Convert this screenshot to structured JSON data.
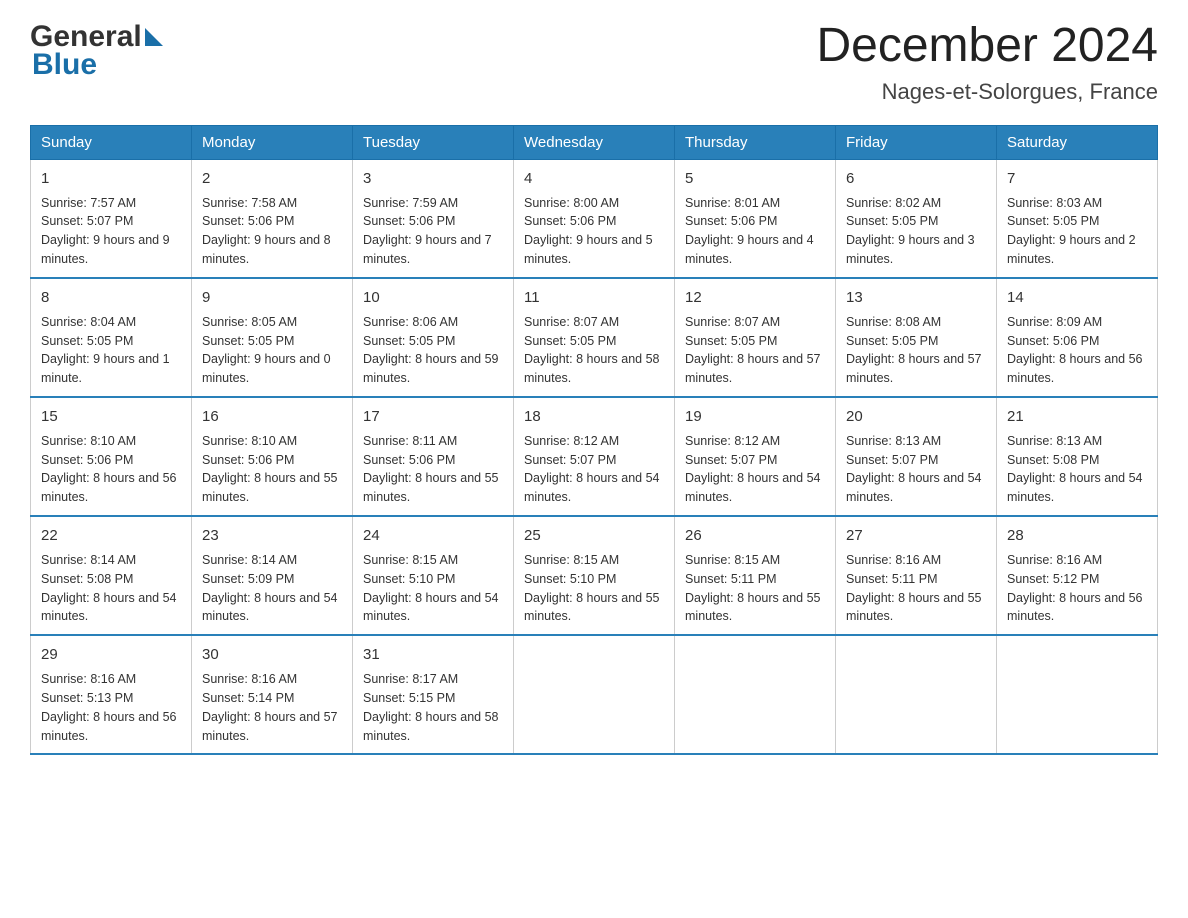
{
  "header": {
    "title": "December 2024",
    "subtitle": "Nages-et-Solorgues, France",
    "logo_general": "General",
    "logo_blue": "Blue"
  },
  "days_of_week": [
    "Sunday",
    "Monday",
    "Tuesday",
    "Wednesday",
    "Thursday",
    "Friday",
    "Saturday"
  ],
  "weeks": [
    [
      {
        "day": "1",
        "sunrise": "7:57 AM",
        "sunset": "5:07 PM",
        "daylight": "9 hours and 9 minutes."
      },
      {
        "day": "2",
        "sunrise": "7:58 AM",
        "sunset": "5:06 PM",
        "daylight": "9 hours and 8 minutes."
      },
      {
        "day": "3",
        "sunrise": "7:59 AM",
        "sunset": "5:06 PM",
        "daylight": "9 hours and 7 minutes."
      },
      {
        "day": "4",
        "sunrise": "8:00 AM",
        "sunset": "5:06 PM",
        "daylight": "9 hours and 5 minutes."
      },
      {
        "day": "5",
        "sunrise": "8:01 AM",
        "sunset": "5:06 PM",
        "daylight": "9 hours and 4 minutes."
      },
      {
        "day": "6",
        "sunrise": "8:02 AM",
        "sunset": "5:05 PM",
        "daylight": "9 hours and 3 minutes."
      },
      {
        "day": "7",
        "sunrise": "8:03 AM",
        "sunset": "5:05 PM",
        "daylight": "9 hours and 2 minutes."
      }
    ],
    [
      {
        "day": "8",
        "sunrise": "8:04 AM",
        "sunset": "5:05 PM",
        "daylight": "9 hours and 1 minute."
      },
      {
        "day": "9",
        "sunrise": "8:05 AM",
        "sunset": "5:05 PM",
        "daylight": "9 hours and 0 minutes."
      },
      {
        "day": "10",
        "sunrise": "8:06 AM",
        "sunset": "5:05 PM",
        "daylight": "8 hours and 59 minutes."
      },
      {
        "day": "11",
        "sunrise": "8:07 AM",
        "sunset": "5:05 PM",
        "daylight": "8 hours and 58 minutes."
      },
      {
        "day": "12",
        "sunrise": "8:07 AM",
        "sunset": "5:05 PM",
        "daylight": "8 hours and 57 minutes."
      },
      {
        "day": "13",
        "sunrise": "8:08 AM",
        "sunset": "5:05 PM",
        "daylight": "8 hours and 57 minutes."
      },
      {
        "day": "14",
        "sunrise": "8:09 AM",
        "sunset": "5:06 PM",
        "daylight": "8 hours and 56 minutes."
      }
    ],
    [
      {
        "day": "15",
        "sunrise": "8:10 AM",
        "sunset": "5:06 PM",
        "daylight": "8 hours and 56 minutes."
      },
      {
        "day": "16",
        "sunrise": "8:10 AM",
        "sunset": "5:06 PM",
        "daylight": "8 hours and 55 minutes."
      },
      {
        "day": "17",
        "sunrise": "8:11 AM",
        "sunset": "5:06 PM",
        "daylight": "8 hours and 55 minutes."
      },
      {
        "day": "18",
        "sunrise": "8:12 AM",
        "sunset": "5:07 PM",
        "daylight": "8 hours and 54 minutes."
      },
      {
        "day": "19",
        "sunrise": "8:12 AM",
        "sunset": "5:07 PM",
        "daylight": "8 hours and 54 minutes."
      },
      {
        "day": "20",
        "sunrise": "8:13 AM",
        "sunset": "5:07 PM",
        "daylight": "8 hours and 54 minutes."
      },
      {
        "day": "21",
        "sunrise": "8:13 AM",
        "sunset": "5:08 PM",
        "daylight": "8 hours and 54 minutes."
      }
    ],
    [
      {
        "day": "22",
        "sunrise": "8:14 AM",
        "sunset": "5:08 PM",
        "daylight": "8 hours and 54 minutes."
      },
      {
        "day": "23",
        "sunrise": "8:14 AM",
        "sunset": "5:09 PM",
        "daylight": "8 hours and 54 minutes."
      },
      {
        "day": "24",
        "sunrise": "8:15 AM",
        "sunset": "5:10 PM",
        "daylight": "8 hours and 54 minutes."
      },
      {
        "day": "25",
        "sunrise": "8:15 AM",
        "sunset": "5:10 PM",
        "daylight": "8 hours and 55 minutes."
      },
      {
        "day": "26",
        "sunrise": "8:15 AM",
        "sunset": "5:11 PM",
        "daylight": "8 hours and 55 minutes."
      },
      {
        "day": "27",
        "sunrise": "8:16 AM",
        "sunset": "5:11 PM",
        "daylight": "8 hours and 55 minutes."
      },
      {
        "day": "28",
        "sunrise": "8:16 AM",
        "sunset": "5:12 PM",
        "daylight": "8 hours and 56 minutes."
      }
    ],
    [
      {
        "day": "29",
        "sunrise": "8:16 AM",
        "sunset": "5:13 PM",
        "daylight": "8 hours and 56 minutes."
      },
      {
        "day": "30",
        "sunrise": "8:16 AM",
        "sunset": "5:14 PM",
        "daylight": "8 hours and 57 minutes."
      },
      {
        "day": "31",
        "sunrise": "8:17 AM",
        "sunset": "5:15 PM",
        "daylight": "8 hours and 58 minutes."
      },
      null,
      null,
      null,
      null
    ]
  ]
}
